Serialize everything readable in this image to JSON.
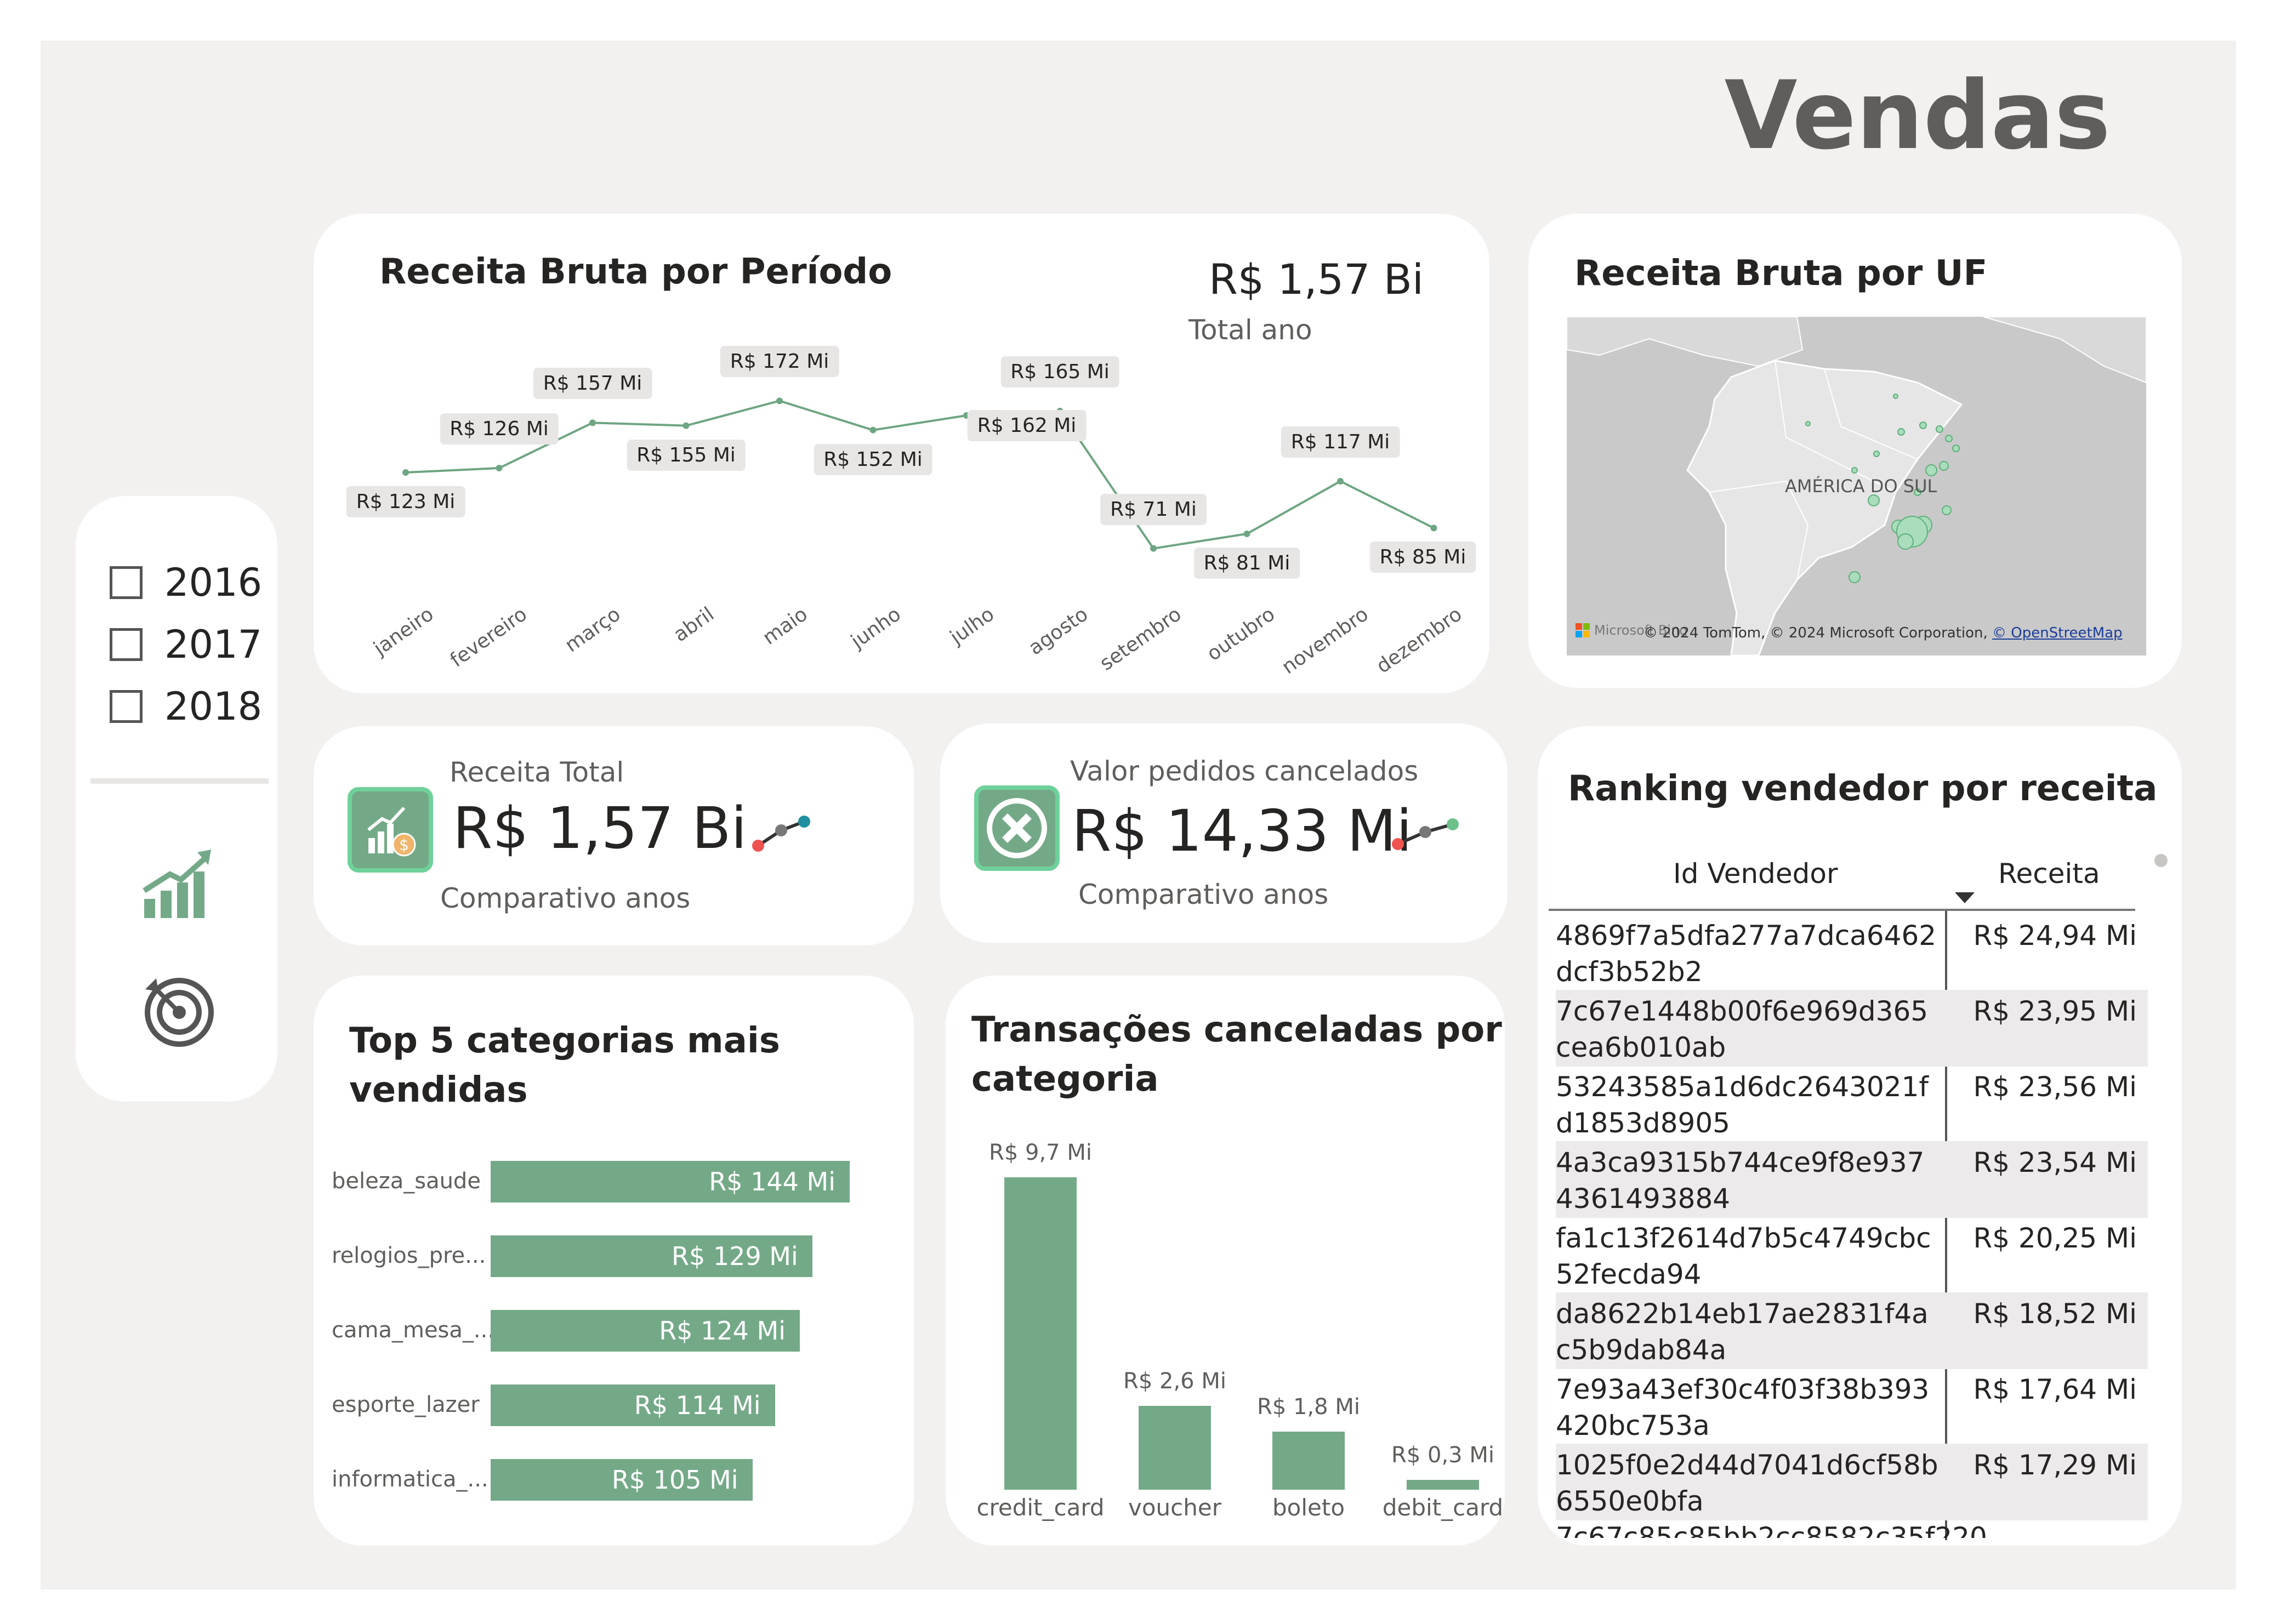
{
  "page": {
    "title": "Vendas"
  },
  "filter": {
    "years": [
      "2016",
      "2017",
      "2018"
    ]
  },
  "nav": {
    "growth_icon": "growth-chart-icon",
    "target_icon": "target-icon"
  },
  "line_card": {
    "title": "Receita Bruta por Período",
    "total_value": "R$ 1,57 Bi",
    "total_caption": "Total ano",
    "labels": [
      "R$ 123 Mi",
      "R$ 126 Mi",
      "R$ 157 Mi",
      "R$ 155 Mi",
      "R$ 172 Mi",
      "R$ 152 Mi",
      "R$ 162 Mi",
      "R$ 165 Mi",
      "R$ 71 Mi",
      "R$ 81 Mi",
      "R$ 117 Mi",
      "R$ 85 Mi"
    ]
  },
  "map_card": {
    "title": "Receita Bruta por UF",
    "map_label": "AMÉRICA DO SUL",
    "attribution": "© 2024 TomTom, © 2024 Microsoft Corporation,",
    "attribution_link": "© OpenStreetMap",
    "brand": "Microsoft Bing"
  },
  "kpi_revenue": {
    "caption": "Receita Total",
    "value": "R$ 1,57 Bi",
    "footer": "Comparativo anos",
    "icon": "revenue-chart-icon"
  },
  "kpi_cancel": {
    "caption": "Valor pedidos cancelados",
    "value": "R$ 14,33 Mi",
    "footer": "Comparativo anos",
    "icon": "cancel-x-icon"
  },
  "top5": {
    "title_line1": "Top 5 categorias mais",
    "title_line2": "vendidas",
    "items": [
      {
        "label": "beleza_saude",
        "value_label": "R$ 144 Mi"
      },
      {
        "label": "relogios_pre...",
        "value_label": "R$ 129 Mi"
      },
      {
        "label": "cama_mesa_...",
        "value_label": "R$ 124 Mi"
      },
      {
        "label": "esporte_lazer",
        "value_label": "R$ 114 Mi"
      },
      {
        "label": "informatica_...",
        "value_label": "R$ 105 Mi"
      }
    ]
  },
  "cancel_by_cat": {
    "title_line1": "Transações canceladas por",
    "title_line2": "categoria",
    "items": [
      {
        "label": "credit_card",
        "value_label": "R$ 9,7 Mi"
      },
      {
        "label": "voucher",
        "value_label": "R$ 2,6 Mi"
      },
      {
        "label": "boleto",
        "value_label": "R$ 1,8 Mi"
      },
      {
        "label": "debit_card",
        "value_label": "R$ 0,3 Mi"
      }
    ]
  },
  "ranking": {
    "title": "Ranking vendedor por receita",
    "col_id": "Id Vendedor",
    "col_rev": "Receita",
    "rows": [
      {
        "id": "4869f7a5dfa277a7dca6462dcf3b52b2",
        "rev": "R$ 24,94 Mi"
      },
      {
        "id": "7c67e1448b00f6e969d365cea6b010ab",
        "rev": "R$ 23,95 Mi"
      },
      {
        "id": "53243585a1d6dc2643021fd1853d8905",
        "rev": "R$ 23,56 Mi"
      },
      {
        "id": "4a3ca9315b744ce9f8e9374361493884",
        "rev": "R$ 23,54 Mi"
      },
      {
        "id": "fa1c13f2614d7b5c4749cbc52fecda94",
        "rev": "R$ 20,25 Mi"
      },
      {
        "id": "da8622b14eb17ae2831f4ac5b9dab84a",
        "rev": "R$ 18,52 Mi"
      },
      {
        "id": "7e93a43ef30c4f03f38b393420bc753a",
        "rev": "R$ 17,64 Mi"
      },
      {
        "id": "1025f0e2d44d7041d6cf58b6550e0bfa",
        "rev": "R$ 17,29 Mi"
      }
    ]
  },
  "chart_data": [
    {
      "type": "line",
      "title": "Receita Bruta por Período",
      "categories": [
        "janeiro",
        "fevereiro",
        "março",
        "abril",
        "maio",
        "junho",
        "julho",
        "agosto",
        "setembro",
        "outubro",
        "novembro",
        "dezembro"
      ],
      "values": [
        123,
        126,
        157,
        155,
        172,
        152,
        162,
        165,
        71,
        81,
        117,
        85
      ],
      "unit": "R$ Mi"
    },
    {
      "type": "bar",
      "orientation": "horizontal",
      "title": "Top 5 categorias mais vendidas",
      "categories": [
        "beleza_saude",
        "relogios_pre...",
        "cama_mesa_...",
        "esporte_lazer",
        "informatica_..."
      ],
      "values": [
        144,
        129,
        124,
        114,
        105
      ],
      "unit": "R$ Mi"
    },
    {
      "type": "bar",
      "title": "Transações canceladas por categoria",
      "categories": [
        "credit_card",
        "voucher",
        "boleto",
        "debit_card"
      ],
      "values": [
        9.7,
        2.6,
        1.8,
        0.3
      ],
      "unit": "R$ Mi"
    }
  ]
}
